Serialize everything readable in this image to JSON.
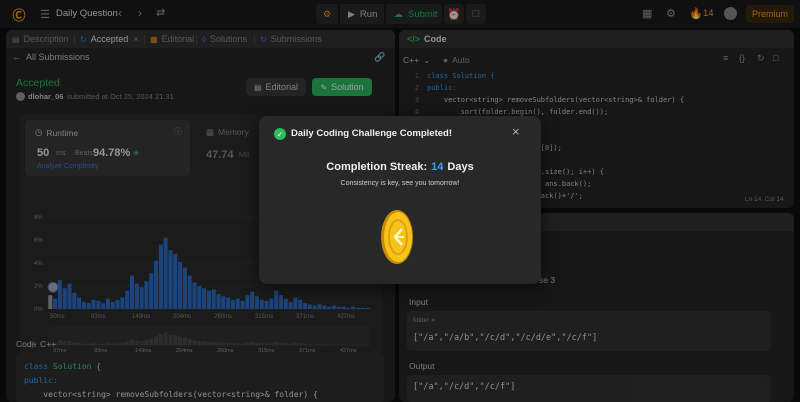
{
  "topbar": {
    "title": "Daily Question",
    "run_label": "Run",
    "submit_label": "Submit",
    "streak_count": "14",
    "premium_label": "Premium"
  },
  "left_tabs": [
    {
      "label": "Description"
    },
    {
      "label": "Accepted"
    },
    {
      "label": "Editorial"
    },
    {
      "label": "Solutions"
    },
    {
      "label": "Submissions"
    }
  ],
  "submission": {
    "back_label": "All Submissions",
    "status": "Accepted",
    "user": "dlohar_06",
    "submitted_at": "submitted at Oct 25, 2024 21:31",
    "editorial_btn": "Editorial",
    "solution_btn": "Solution"
  },
  "runtime": {
    "label": "Runtime",
    "value": "50",
    "unit": "ms",
    "beats_label": "Beats",
    "beats_value": "94.78%",
    "analyze_label": "Analyze Complexity"
  },
  "memory": {
    "label": "Memory",
    "value": "47.74",
    "unit": "MB"
  },
  "chart_data": {
    "type": "bar",
    "y_ticks": [
      "8%",
      "6%",
      "4%",
      "2%",
      "0%"
    ],
    "ylim": [
      0,
      8
    ],
    "x_ticks": [
      "50ms",
      "93ms",
      "149ms",
      "204ms",
      "260ms",
      "315ms",
      "371ms",
      "427ms"
    ],
    "x_ticks_bottom": [
      "37ms",
      "93ms",
      "149ms",
      "204ms",
      "260ms",
      "315ms",
      "371ms",
      "427ms"
    ],
    "values": [
      1.2,
      0.9,
      2.5,
      1.8,
      2.2,
      1.4,
      1.0,
      0.6,
      0.5,
      0.8,
      0.7,
      0.5,
      0.9,
      0.6,
      0.8,
      1.0,
      1.6,
      2.9,
      2.2,
      1.9,
      2.4,
      3.1,
      4.2,
      5.6,
      6.2,
      5.1,
      4.8,
      4.1,
      3.6,
      2.9,
      2.3,
      2.0,
      1.8,
      1.6,
      1.7,
      1.3,
      1.1,
      1.0,
      0.8,
      0.9,
      0.7,
      1.2,
      1.5,
      1.1,
      0.8,
      0.7,
      0.9,
      1.6,
      1.2,
      0.9,
      0.6,
      1.0,
      0.8,
      0.5,
      0.4,
      0.3,
      0.4,
      0.3,
      0.2,
      0.3,
      0.2,
      0.2,
      0.1,
      0.2,
      0.1,
      0.1,
      0.1
    ],
    "highlight_value": 1.2,
    "bar_color": "#2d6fc9",
    "highlight_color": "#a0a0a0"
  },
  "code_section": {
    "header": "Code",
    "lang": "C++",
    "lines": [
      "class Solution {",
      "public:",
      "    vector<string> removeSubfolders(vector<string>& folder) {"
    ]
  },
  "right_panel": {
    "title": "Code",
    "lang": "C++",
    "auto_label": "Auto",
    "editor_lines": [
      {
        "n": "1",
        "code": "class Solution {"
      },
      {
        "n": "2",
        "code": "public:"
      },
      {
        "n": "3",
        "code": "    vector<string> removeSubfolders(vector<string>& folder) {"
      },
      {
        "n": "4",
        "code": "        sort(folder.begin(), folder.end());"
      },
      {
        "n": "5",
        "code": ""
      },
      {
        "n": "6",
        "code": ""
      },
      {
        "n": "7",
        "code": "                          r[0]);"
      },
      {
        "n": "8",
        "code": ""
      },
      {
        "n": "9",
        "code": "                     folder.size(); i++) {"
      },
      {
        "n": "10",
        "code": "                          = ans.back();"
      },
      {
        "n": "11",
        "code": "                          back()+'/';"
      }
    ],
    "cursor_info": "Ln 14, Col 14"
  },
  "testcase": {
    "case_label": "se 3",
    "input_label": "Input",
    "input_var": "folder =",
    "input_value": "[\"/a\",\"/a/b\",\"/c/d\",\"/c/d/e\",\"/c/f\"]",
    "output_label": "Output",
    "output_value": "[\"/a\",\"/c/d\",\"/c/f\"]"
  },
  "modal": {
    "title": "Daily Coding Challenge Completed!",
    "streak_label": "Completion Streak:",
    "streak_number": "14",
    "streak_unit": "Days",
    "subtitle": "Consistency is key, see you tomorrow!"
  }
}
